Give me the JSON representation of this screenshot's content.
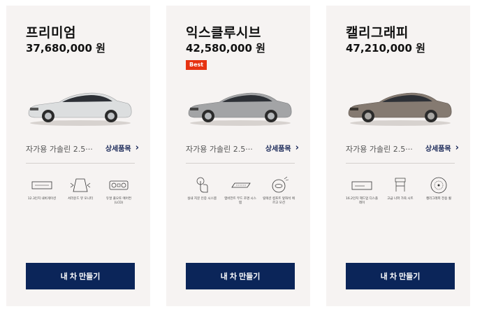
{
  "cards": [
    {
      "trim": "프리미엄",
      "price": "37,680,000 원",
      "badge": "",
      "car_color": "#dcdedf",
      "spec": "자가용 가솔린 2.5···",
      "detail_label": "상세품목",
      "options": [
        {
          "icon": "instrument-cluster-icon",
          "label": "12.3인치 내비게이션"
        },
        {
          "icon": "surround-view-icon",
          "label": "서라운드 뷰 모니터"
        },
        {
          "icon": "climate-panel-icon",
          "label": "듀얼 풀오토 에어컨 (LCD)"
        }
      ],
      "build_label": "내 차 만들기"
    },
    {
      "trim": "익스클루시브",
      "price": "42,580,000 원",
      "badge": "Best",
      "car_color": "#a3a4a6",
      "spec": "자가용 가솔린 2.5···",
      "detail_label": "상세품목",
      "options": [
        {
          "icon": "touch-control-icon",
          "label": "실내 지문 인증 시스템"
        },
        {
          "icon": "ambient-light-icon",
          "label": "앰비언트 무드 조명 시스템"
        },
        {
          "icon": "seat-massage-icon",
          "label": "릴렉션 컴포트 앞좌석 에르고 모션"
        }
      ],
      "build_label": "내 차 만들기"
    },
    {
      "trim": "캘리그래피",
      "price": "47,210,000 원",
      "badge": "",
      "car_color": "#857a71",
      "spec": "자가용 가솔린 2.5···",
      "detail_label": "상세품목",
      "options": [
        {
          "icon": "display-panel-icon",
          "label": "16.2인치 헤드업 디스플레이"
        },
        {
          "icon": "seat-icon",
          "label": "고급 나파 가죽 시트"
        },
        {
          "icon": "wheel-icon",
          "label": "캘리그래피 전용 휠"
        }
      ],
      "build_label": "내 차 만들기"
    }
  ]
}
